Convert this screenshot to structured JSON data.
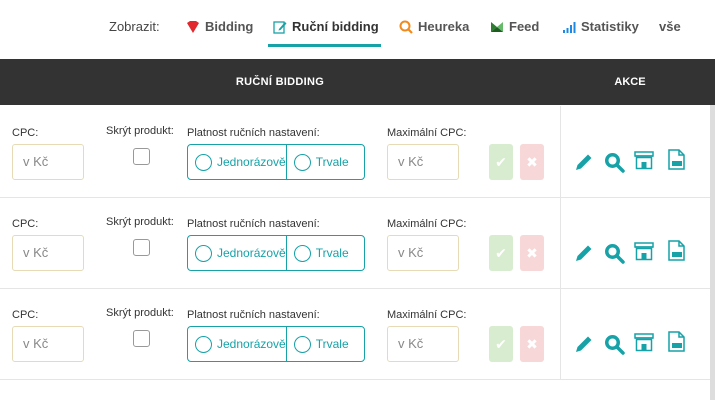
{
  "nav": {
    "label": "Zobrazit:",
    "items": [
      {
        "label": "Bidding",
        "icon": "diamond-icon"
      },
      {
        "label": "Ruční bidding",
        "icon": "edit-icon"
      },
      {
        "label": "Heureka",
        "icon": "heureka-icon"
      },
      {
        "label": "Feed",
        "icon": "feed-icon"
      },
      {
        "label": "Statistiky",
        "icon": "bar-chart-icon"
      },
      {
        "label": "vše"
      }
    ],
    "active": "Ruční bidding"
  },
  "header": {
    "title": "RUČNÍ BIDDING",
    "actions": "AKCE"
  },
  "labels": {
    "cpc": "CPC:",
    "hide_product": "Skrýt produkt:",
    "validity": "Platnost ručních nastavení:",
    "max_cpc": "Maximální CPC:",
    "one_time": "Jednorázově",
    "permanent": "Trvale",
    "cpc_placeholder": "v Kč",
    "max_cpc_placeholder": "v Kč",
    "ok_symbol": "✔",
    "cancel_symbol": "✖"
  },
  "rows": [
    {
      "id": 1
    },
    {
      "id": 2
    },
    {
      "id": 3
    }
  ],
  "colors": {
    "accent": "#17a2a8",
    "header_bg": "#333333",
    "input_border": "#e6dbb6",
    "ok_bg": "#d8ecd0",
    "cancel_bg": "#f7d7d7",
    "bidding_icon": "#e0282e",
    "heureka_icon": "#f08a1e",
    "feed_icon": "#4caf50"
  }
}
